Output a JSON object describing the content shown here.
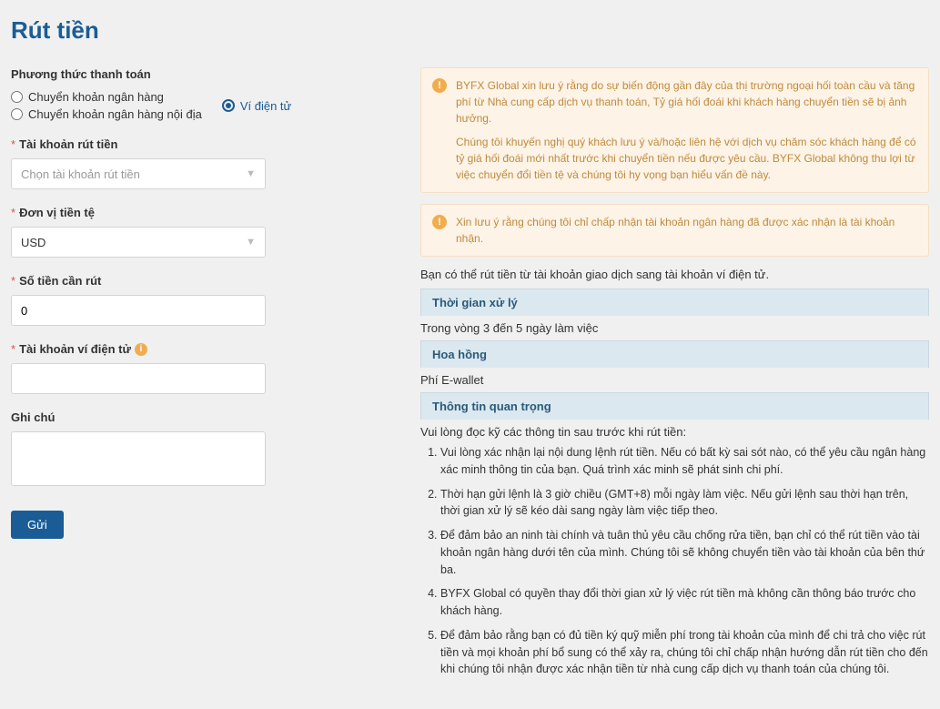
{
  "page": {
    "title": "Rút tiền"
  },
  "form": {
    "payment_method_label": "Phương thức thanh toán",
    "radios": {
      "bank": "Chuyển khoản ngân hàng",
      "domestic_bank": "Chuyển khoản ngân hàng nội địa",
      "ewallet": "Ví điện tử"
    },
    "account_label": "Tài khoản rút tiền",
    "account_placeholder": "Chọn tài khoản rút tiền",
    "currency_label": "Đơn vị tiền tệ",
    "currency_value": "USD",
    "amount_label": "Số tiền cần rút",
    "amount_value": "0",
    "ewallet_account_label": "Tài khoản ví điện tử",
    "note_label": "Ghi chú",
    "submit_label": "Gửi"
  },
  "alerts": {
    "p1": "BYFX Global xin lưu ý rằng do sự biến động gần đây của thị trường ngoại hối toàn cầu và tăng phí từ Nhà cung cấp dịch vụ thanh toán, Tỷ giá hối đoái khi khách hàng chuyển tiền sẽ bị ảnh hưởng.",
    "p2": "Chúng tôi khuyến nghị quý khách lưu ý và/hoặc liên hệ với dịch vụ chăm sóc khách hàng để có tỷ giá hối đoái mới nhất trước khi chuyển tiền nếu được yêu cầu. BYFX Global không thu lợi từ việc chuyển đổi tiền tệ và chúng tôi hy vọng bạn hiểu vấn đề này.",
    "p3": "Xin lưu ý rằng chúng tôi chỉ chấp nhận tài khoản ngân hàng đã được xác nhận là tài khoản nhận."
  },
  "info": {
    "intro": "Bạn có thể rút tiền từ tài khoản giao dịch sang tài khoản ví điện tử.",
    "time_header": "Thời gian xử lý",
    "time_body": "Trong vòng 3 đến 5 ngày làm việc",
    "fee_header": "Hoa hồng",
    "fee_body": "Phí E-wallet",
    "important_header": "Thông tin quan trọng",
    "important_intro": "Vui lòng đọc kỹ các thông tin sau trước khi rút tiền:",
    "items": [
      "Vui lòng xác nhận lại nội dung lệnh rút tiền. Nếu có bất kỳ sai sót nào, có thể yêu cầu ngân hàng xác minh thông tin của bạn. Quá trình xác minh sẽ phát sinh chi phí.",
      "Thời hạn gửi lệnh là 3 giờ chiều (GMT+8) mỗi ngày làm việc. Nếu gửi lệnh sau thời hạn trên, thời gian xử lý sẽ kéo dài sang ngày làm việc tiếp theo.",
      "Để đảm bảo an ninh tài chính và tuân thủ yêu cầu chống rửa tiền, bạn chỉ có thể rút tiền vào tài khoản ngân hàng dưới tên của mình. Chúng tôi sẽ không chuyển tiền vào tài khoản của bên thứ ba.",
      "BYFX Global có quyền thay đổi thời gian xử lý việc rút tiền mà không cần thông báo trước cho khách hàng.",
      "Để đảm bảo rằng bạn có đủ tiền ký quỹ miễn phí trong tài khoản của mình để chi trả cho việc rút tiền và mọi khoản phí bổ sung có thể xảy ra, chúng tôi chỉ chấp nhận hướng dẫn rút tiền cho đến khi chúng tôi nhận được xác nhận tiền từ nhà cung cấp dịch vụ thanh toán của chúng tôi."
    ]
  }
}
